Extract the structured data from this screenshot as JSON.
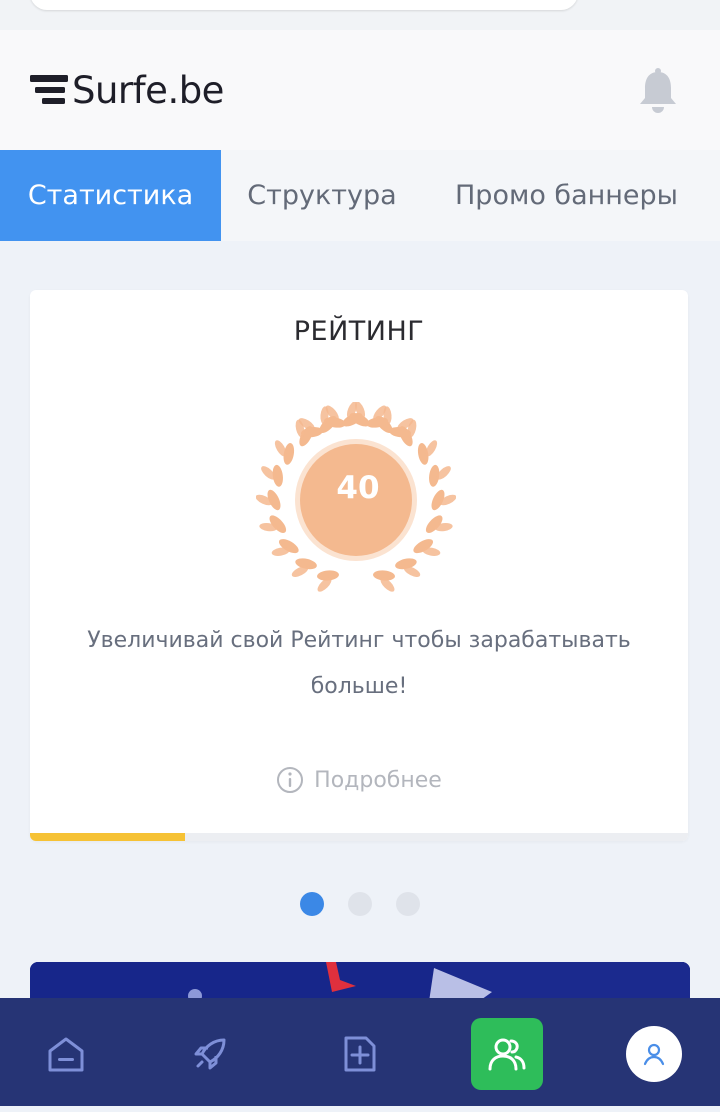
{
  "brand": {
    "name": "Surfe.be"
  },
  "tabs": [
    {
      "label": "Статистика",
      "active": true
    },
    {
      "label": "Структура",
      "active": false
    },
    {
      "label": "Промо баннеры",
      "active": false
    }
  ],
  "rating_card": {
    "title": "РЕЙТИНГ",
    "value": "40",
    "description": "Увеличивай свой Рейтинг чтобы зарабатывать больше!",
    "more_label": "Подробнее",
    "progress": 0.235
  },
  "carousel": {
    "count": 3,
    "active_index": 0
  },
  "bottom_nav": {
    "items": [
      {
        "icon": "home-icon",
        "active": false
      },
      {
        "icon": "rocket-icon",
        "active": false
      },
      {
        "icon": "add-document-icon",
        "active": false
      },
      {
        "icon": "referrals-icon",
        "active": true
      },
      {
        "icon": "profile-icon",
        "active": false
      }
    ]
  },
  "colors": {
    "accent": "#4293f0",
    "nav_bg": "#263475",
    "nav_active": "#2ebd5a",
    "progress": "#f6c235",
    "badge": "#f4b98f"
  }
}
